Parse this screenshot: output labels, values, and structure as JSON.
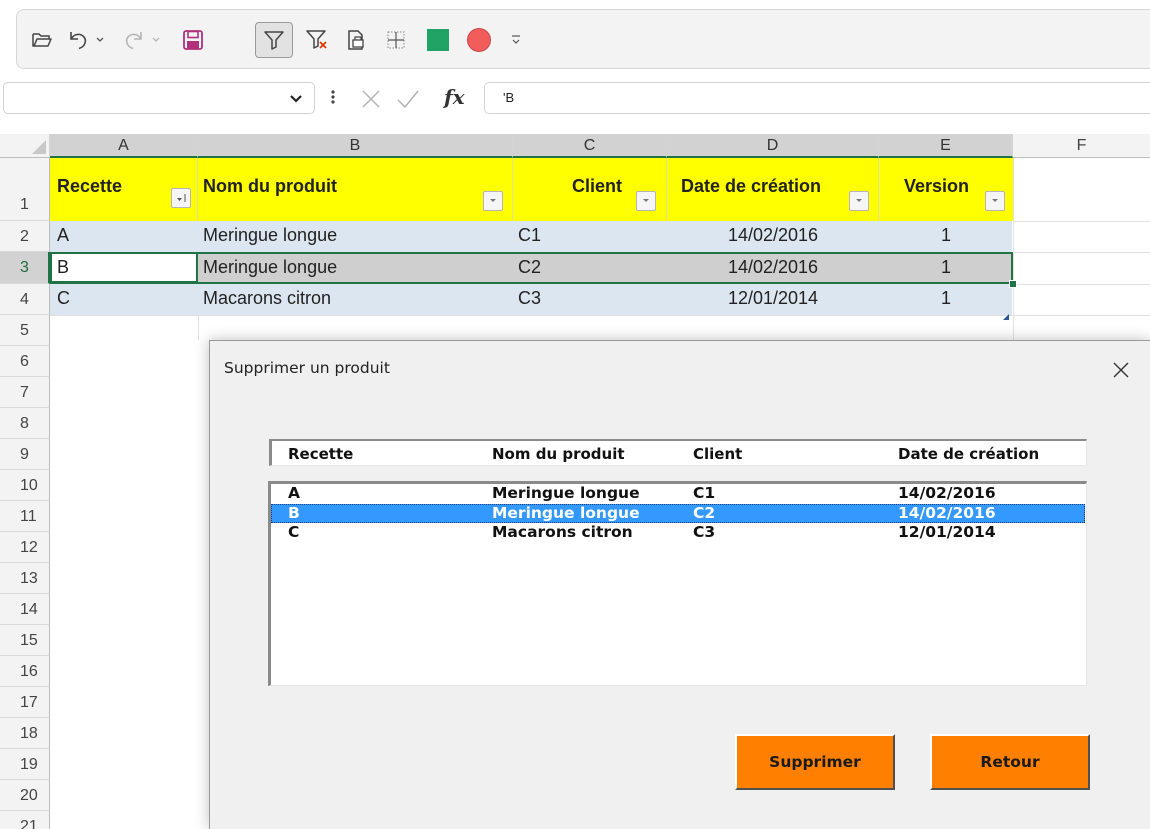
{
  "toolbar": {
    "icons": [
      "open-folder-icon",
      "undo-icon",
      "undo-dropdown-icon",
      "redo-icon",
      "redo-dropdown-icon",
      "save-icon",
      "filter-icon",
      "clear-filter-icon",
      "print-preview-icon",
      "borders-icon",
      "green-square-icon",
      "red-circle-icon",
      "customize-toolbar-icon"
    ],
    "active": "filter-icon"
  },
  "formula_bar": {
    "name_box": "",
    "fx_label": "fx",
    "content": "'B"
  },
  "columns": [
    "A",
    "B",
    "C",
    "D",
    "E",
    "F"
  ],
  "rows": [
    "1",
    "2",
    "3",
    "4",
    "5",
    "6",
    "7",
    "8",
    "9",
    "10",
    "11",
    "12",
    "13",
    "14",
    "15",
    "16",
    "17",
    "18",
    "19",
    "20",
    "21"
  ],
  "table": {
    "headers": [
      "Recette",
      "Nom du produit",
      "Client",
      "Date de création",
      "Version"
    ],
    "data": [
      [
        "A",
        "Meringue longue",
        "C1",
        "14/02/2016",
        "1"
      ],
      [
        "B",
        "Meringue longue",
        "C2",
        "14/02/2016",
        "1"
      ],
      [
        "C",
        "Macarons citron",
        "C3",
        "12/01/2014",
        "1"
      ]
    ],
    "selected_row": 3
  },
  "colors": {
    "header_fill": "#ffff00",
    "band_fill": "#dce6f1",
    "selection_border": "#217346",
    "button_fill": "#ff8000",
    "list_selection": "#3399ff"
  },
  "dialog": {
    "title": "Supprimer un produit",
    "list_headers": [
      "Recette",
      "Nom du produit",
      "Client",
      "Date de création"
    ],
    "list_rows": [
      [
        "A",
        "Meringue longue",
        "C1",
        "14/02/2016"
      ],
      [
        "B",
        "Meringue longue",
        "C2",
        "14/02/2016"
      ],
      [
        "C",
        "Macarons citron",
        "C3",
        "12/01/2014"
      ]
    ],
    "selected_index": 1,
    "delete_label": "Supprimer",
    "back_label": "Retour"
  }
}
